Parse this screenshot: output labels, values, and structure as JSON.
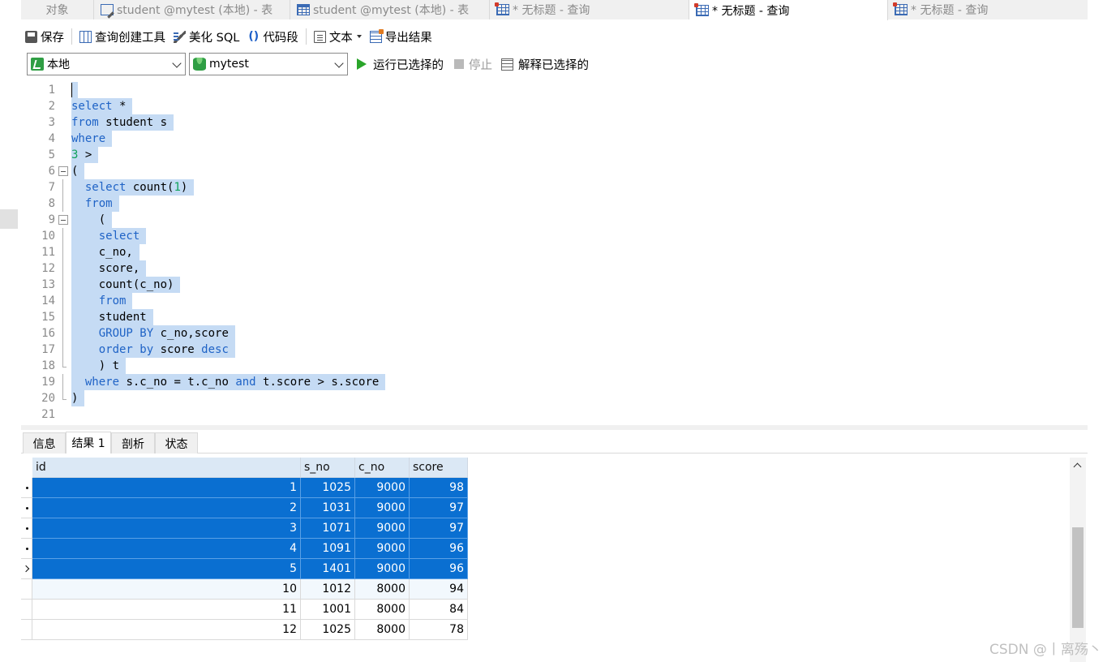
{
  "tabs": [
    {
      "label": "对象",
      "icon": "none"
    },
    {
      "label": "student @mytest (本地) - 表",
      "icon": "table-edit-icon"
    },
    {
      "label": "student @mytest (本地) - 表",
      "icon": "table-icon"
    },
    {
      "label": "* 无标题 - 查询",
      "icon": "query-icon"
    },
    {
      "label": "* 无标题 - 查询",
      "icon": "query-icon",
      "active": true
    },
    {
      "label": "* 无标题 - 查询",
      "icon": "query-icon"
    }
  ],
  "toolbar": {
    "save": "保存",
    "query_builder": "查询创建工具",
    "beautify": "美化 SQL",
    "snippet_glyph": "()",
    "snippet": "代码段",
    "text": "文本",
    "export": "导出结果"
  },
  "runbar": {
    "connection": "本地",
    "database": "mytest",
    "run_selected": "运行已选择的",
    "stop": "停止",
    "explain_selected": "解释已选择的"
  },
  "editor": {
    "lines": [
      {
        "n": "1",
        "tokens": []
      },
      {
        "n": "2",
        "tokens": [
          {
            "t": "select",
            "k": "kw"
          },
          {
            "t": " *"
          }
        ]
      },
      {
        "n": "3",
        "tokens": [
          {
            "t": "from",
            "k": "kw"
          },
          {
            "t": " student s"
          }
        ]
      },
      {
        "n": "4",
        "tokens": [
          {
            "t": "where",
            "k": "kw"
          }
        ]
      },
      {
        "n": "5",
        "tokens": [
          {
            "t": "3",
            "k": "num"
          },
          {
            "t": " >"
          }
        ]
      },
      {
        "n": "6",
        "tokens": [
          {
            "t": "("
          }
        ],
        "fold": "box"
      },
      {
        "n": "7",
        "tokens": [
          {
            "t": "  "
          },
          {
            "t": "select",
            "k": "kw"
          },
          {
            "t": " count("
          },
          {
            "t": "1",
            "k": "num"
          },
          {
            "t": ")"
          }
        ],
        "fold": "bar"
      },
      {
        "n": "8",
        "tokens": [
          {
            "t": "  "
          },
          {
            "t": "from",
            "k": "kw"
          }
        ],
        "fold": "bar"
      },
      {
        "n": "9",
        "tokens": [
          {
            "t": "    ("
          }
        ],
        "fold": "box"
      },
      {
        "n": "10",
        "tokens": [
          {
            "t": "    "
          },
          {
            "t": "select",
            "k": "kw"
          }
        ],
        "fold": "bar"
      },
      {
        "n": "11",
        "tokens": [
          {
            "t": "    c_no,"
          }
        ],
        "fold": "bar"
      },
      {
        "n": "12",
        "tokens": [
          {
            "t": "    score,"
          }
        ],
        "fold": "bar"
      },
      {
        "n": "13",
        "tokens": [
          {
            "t": "    count(c_no)"
          }
        ],
        "fold": "bar"
      },
      {
        "n": "14",
        "tokens": [
          {
            "t": "    "
          },
          {
            "t": "from",
            "k": "kw"
          }
        ],
        "fold": "bar"
      },
      {
        "n": "15",
        "tokens": [
          {
            "t": "    student"
          }
        ],
        "fold": "bar"
      },
      {
        "n": "16",
        "tokens": [
          {
            "t": "    "
          },
          {
            "t": "GROUP BY",
            "k": "kw"
          },
          {
            "t": " c_no,score"
          }
        ],
        "fold": "bar"
      },
      {
        "n": "17",
        "tokens": [
          {
            "t": "    "
          },
          {
            "t": "order by",
            "k": "kw"
          },
          {
            "t": " score "
          },
          {
            "t": "desc",
            "k": "kw"
          }
        ],
        "fold": "bar"
      },
      {
        "n": "18",
        "tokens": [
          {
            "t": "    ) t"
          }
        ],
        "fold": "end"
      },
      {
        "n": "19",
        "tokens": [
          {
            "t": "  "
          },
          {
            "t": "where",
            "k": "kw"
          },
          {
            "t": " s.c_no = t.c_no "
          },
          {
            "t": "and",
            "k": "kw"
          },
          {
            "t": " t.score > s.score"
          }
        ],
        "fold": "bar"
      },
      {
        "n": "20",
        "tokens": [
          {
            "t": ")"
          }
        ],
        "fold": "end"
      },
      {
        "n": "21",
        "tokens": [],
        "unselected": true
      }
    ]
  },
  "result_tabs": [
    {
      "label": "信息"
    },
    {
      "label": "结果 1",
      "active": true
    },
    {
      "label": "剖析"
    },
    {
      "label": "状态"
    }
  ],
  "grid": {
    "columns": [
      "id",
      "s_no",
      "c_no",
      "score"
    ],
    "rows": [
      {
        "cells": [
          "1",
          "1025",
          "9000",
          "98"
        ],
        "selected": true,
        "marker": "dot"
      },
      {
        "cells": [
          "2",
          "1031",
          "9000",
          "97"
        ],
        "selected": true,
        "marker": "dot"
      },
      {
        "cells": [
          "3",
          "1071",
          "9000",
          "97"
        ],
        "selected": true,
        "marker": "dot"
      },
      {
        "cells": [
          "4",
          "1091",
          "9000",
          "96"
        ],
        "selected": true,
        "marker": "dot"
      },
      {
        "cells": [
          "5",
          "1401",
          "9000",
          "96"
        ],
        "selected": true,
        "marker": "current"
      },
      {
        "cells": [
          "10",
          "1012",
          "8000",
          "94"
        ],
        "selected": false,
        "alt": true
      },
      {
        "cells": [
          "11",
          "1001",
          "8000",
          "84"
        ],
        "selected": false
      },
      {
        "cells": [
          "12",
          "1025",
          "8000",
          "78"
        ],
        "selected": false
      }
    ]
  },
  "watermark": "CSDN @丨离殇丶",
  "colors": {
    "keyword": "#1f63c6",
    "number": "#11a25a",
    "selection": "#c5dbf4",
    "grid_selected": "#0a6fd1",
    "grid_header": "#dbe8f5"
  }
}
